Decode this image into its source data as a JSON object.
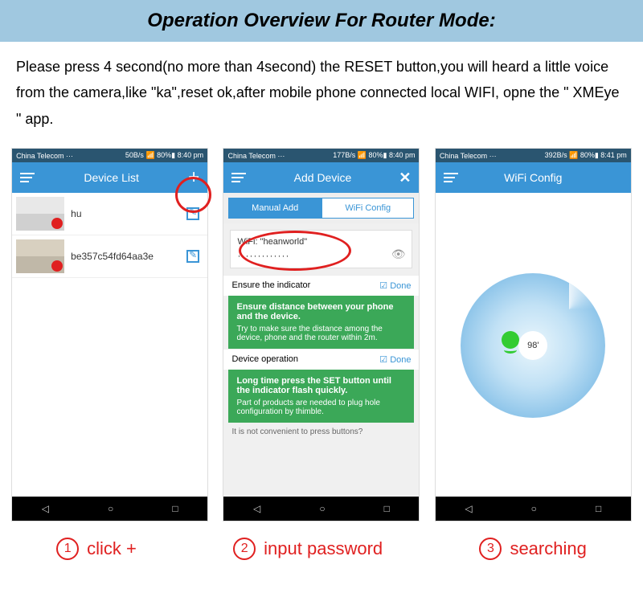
{
  "header": {
    "title": "Operation Overview For Router Mode:"
  },
  "instructions": "Please press 4 second(no more than 4second) the RESET button,you will heard a little voice from the camera,like \"ka\",reset ok,after mobile phone connected local WIFI, opne the \" XMEye \"  app.",
  "statusBar": {
    "carrier": "China Telecom ···",
    "net1": "50B/s",
    "net2": "177B/s",
    "net3": "392B/s",
    "battery": "80%",
    "time1": "8:40 pm",
    "time2": "8:40 pm",
    "time3": "8:41 pm"
  },
  "phone1": {
    "title": "Device List",
    "devices": [
      {
        "name": "hu"
      },
      {
        "name": "be357c54fd64aa3e"
      }
    ]
  },
  "phone2": {
    "title": "Add Device",
    "tabManual": "Manual Add",
    "tabWifi": "WiFi Config",
    "wifiLabel": "WiFi: \"heanworld\"",
    "password": "·············",
    "section1Title": "Ensure the indicator",
    "done": "Done",
    "green1Bold": "Ensure distance between your phone and the device.",
    "green1Text": "Try to make sure the distance among the device, phone and the router within 2m.",
    "section2Title": "Device operation",
    "green2Bold": "Long time press the SET button until the indicator flash quickly.",
    "green2Text": "Part of products are needed to plug hole configuration by thimble.",
    "bottomText": "It is not convenient to press buttons?"
  },
  "phone3": {
    "title": "WiFi Config",
    "radarValue": "98'"
  },
  "captions": {
    "c1num": "1",
    "c1": "click +",
    "c2num": "2",
    "c2": "input password",
    "c3num": "3",
    "c3": "searching"
  }
}
